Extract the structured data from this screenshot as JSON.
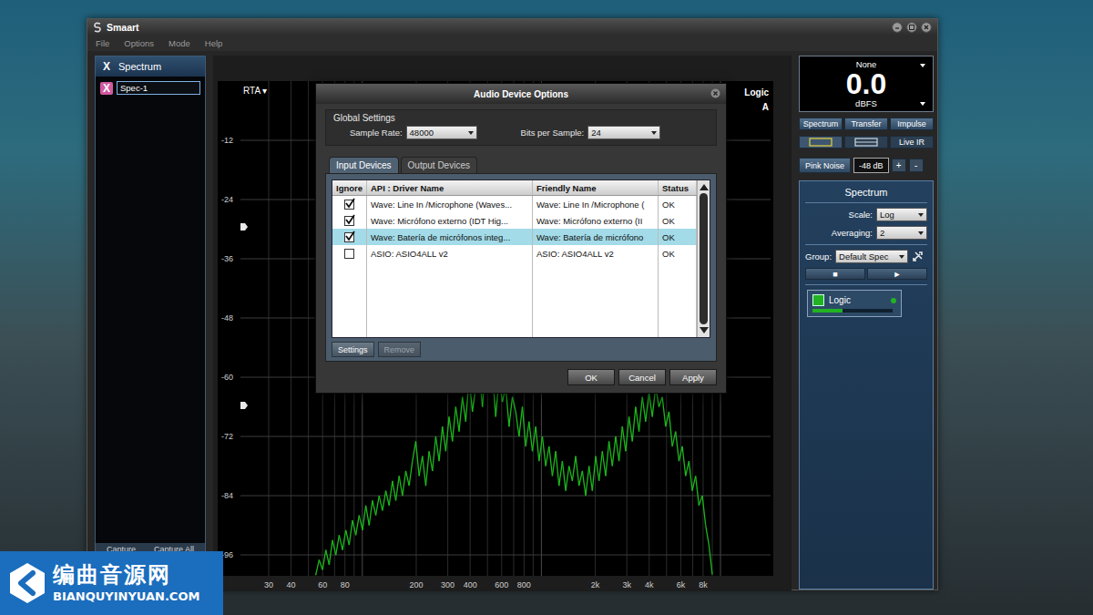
{
  "window": {
    "title": "Smaart"
  },
  "menu": [
    "File",
    "Options",
    "Mode",
    "Help"
  ],
  "left_panel": {
    "close_icon": "X",
    "title": "Spectrum",
    "items": [
      {
        "icon": "X",
        "name": "Spec-1",
        "selected": true
      }
    ],
    "buttons": [
      "Capture",
      "Capture All"
    ]
  },
  "plot": {
    "mode": "RTA ▾",
    "label": "Logic",
    "sublabel": "A",
    "y_ticks": [
      {
        "label": "-12",
        "db": -12
      },
      {
        "label": "-24",
        "db": -24
      },
      {
        "label": "-36",
        "db": -36
      },
      {
        "label": "-48",
        "db": -48
      },
      {
        "label": "-60",
        "db": -60
      },
      {
        "label": "-72",
        "db": -72
      },
      {
        "label": "-84",
        "db": -84
      },
      {
        "label": "-96",
        "db": -96
      }
    ],
    "x_ticks": [
      {
        "label": "30",
        "hz": 30
      },
      {
        "label": "40",
        "hz": 40
      },
      {
        "label": "60",
        "hz": 60
      },
      {
        "label": "80",
        "hz": 80
      },
      {
        "label": "200",
        "hz": 200
      },
      {
        "label": "300",
        "hz": 300
      },
      {
        "label": "400",
        "hz": 400
      },
      {
        "label": "600",
        "hz": 600
      },
      {
        "label": "800",
        "hz": 800
      },
      {
        "label": "2k",
        "hz": 2000
      },
      {
        "label": "3k",
        "hz": 3000
      },
      {
        "label": "4k",
        "hz": 4000
      },
      {
        "label": "6k",
        "hz": 6000
      },
      {
        "label": "8k",
        "hz": 8000
      }
    ],
    "series": [
      {
        "color": "#1cb81c",
        "f_min": 55,
        "f_max": 9000,
        "values": [
          -100,
          -97,
          -99,
          -95,
          -98,
          -93,
          -96,
          -92,
          -95,
          -91,
          -94,
          -89,
          -92,
          -88,
          -91,
          -86,
          -90,
          -85,
          -88,
          -84,
          -87,
          -83,
          -86,
          -81,
          -85,
          -80,
          -84,
          -79,
          -82,
          -77,
          -73,
          -80,
          -76,
          -82,
          -75,
          -79,
          -72,
          -77,
          -70,
          -75,
          -68,
          -73,
          -66,
          -71,
          -64,
          -69,
          -60,
          -67,
          -62,
          -58,
          -66,
          -57,
          -63,
          -59,
          -68,
          -60,
          -65,
          -62,
          -70,
          -64,
          -67,
          -72,
          -66,
          -74,
          -69,
          -75,
          -70,
          -77,
          -72,
          -78,
          -74,
          -80,
          -75,
          -82,
          -77,
          -83,
          -78,
          -81,
          -76,
          -82,
          -79,
          -84,
          -78,
          -83,
          -76,
          -81,
          -75,
          -80,
          -73,
          -78,
          -72,
          -77,
          -70,
          -75,
          -68,
          -73,
          -66,
          -71,
          -64,
          -69,
          -63,
          -68,
          -62,
          -66,
          -64,
          -70,
          -67,
          -74,
          -71,
          -77,
          -74,
          -80,
          -77,
          -83,
          -80,
          -86,
          -84,
          -90,
          -94,
          -100
        ]
      }
    ]
  },
  "dialog": {
    "title": "Audio Device Options",
    "group_title": "Global Settings",
    "sample_rate": {
      "label": "Sample Rate:",
      "value": "48000"
    },
    "bits": {
      "label": "Bits per Sample:",
      "value": "24"
    },
    "tabs": [
      {
        "label": "Input Devices",
        "selected": true
      },
      {
        "label": "Output Devices",
        "selected": false
      }
    ],
    "table": {
      "columns": [
        "Ignore",
        "API : Driver Name",
        "Friendly Name",
        "Status"
      ],
      "rows": [
        {
          "ignore": true,
          "driver": "Wave: Line In /Microphone (Waves...",
          "friendly": "Wave: Line In /Microphone (",
          "status": "OK",
          "selected": false
        },
        {
          "ignore": true,
          "driver": "Wave: Micrófono externo (IDT Hig...",
          "friendly": "Wave: Micrófono externo (II",
          "status": "OK",
          "selected": false
        },
        {
          "ignore": true,
          "driver": "Wave: Batería de micrófonos integ...",
          "friendly": "Wave: Batería de micrófono",
          "status": "OK",
          "selected": true
        },
        {
          "ignore": false,
          "driver": "ASIO: ASIO4ALL v2",
          "friendly": "ASIO: ASIO4ALL v2",
          "status": "OK",
          "selected": false
        }
      ]
    },
    "buttons": [
      {
        "label": "Settings",
        "disabled": false
      },
      {
        "label": "Remove",
        "disabled": true
      }
    ],
    "footer_buttons": [
      "OK",
      "Cancel",
      "Apply"
    ]
  },
  "right_panel": {
    "meter": {
      "source": "None",
      "value": "0.0",
      "unit": "dBFS"
    },
    "modes": [
      "Spectrum",
      "Transfer",
      "Impulse"
    ],
    "views": [
      {
        "selected": true
      },
      {
        "selected": false
      }
    ],
    "live_ir": "Live IR",
    "generator": {
      "label": "Pink Noise",
      "level": "-48 dB",
      "plus": "+",
      "minus": "-"
    },
    "spectrum": {
      "title": "Spectrum",
      "scale": {
        "label": "Scale:",
        "value": "Log"
      },
      "averaging": {
        "label": "Averaging:",
        "value": "2"
      },
      "group": {
        "label": "Group:",
        "value": "Default Spec"
      },
      "transport": [
        "■",
        "►"
      ],
      "measurements": [
        {
          "name": "Logic",
          "color": "#22b322",
          "active": true,
          "level": 0.38
        }
      ]
    }
  },
  "watermark": {
    "title": "编曲音源网",
    "url": "BIANQUYINYUAN.COM"
  }
}
